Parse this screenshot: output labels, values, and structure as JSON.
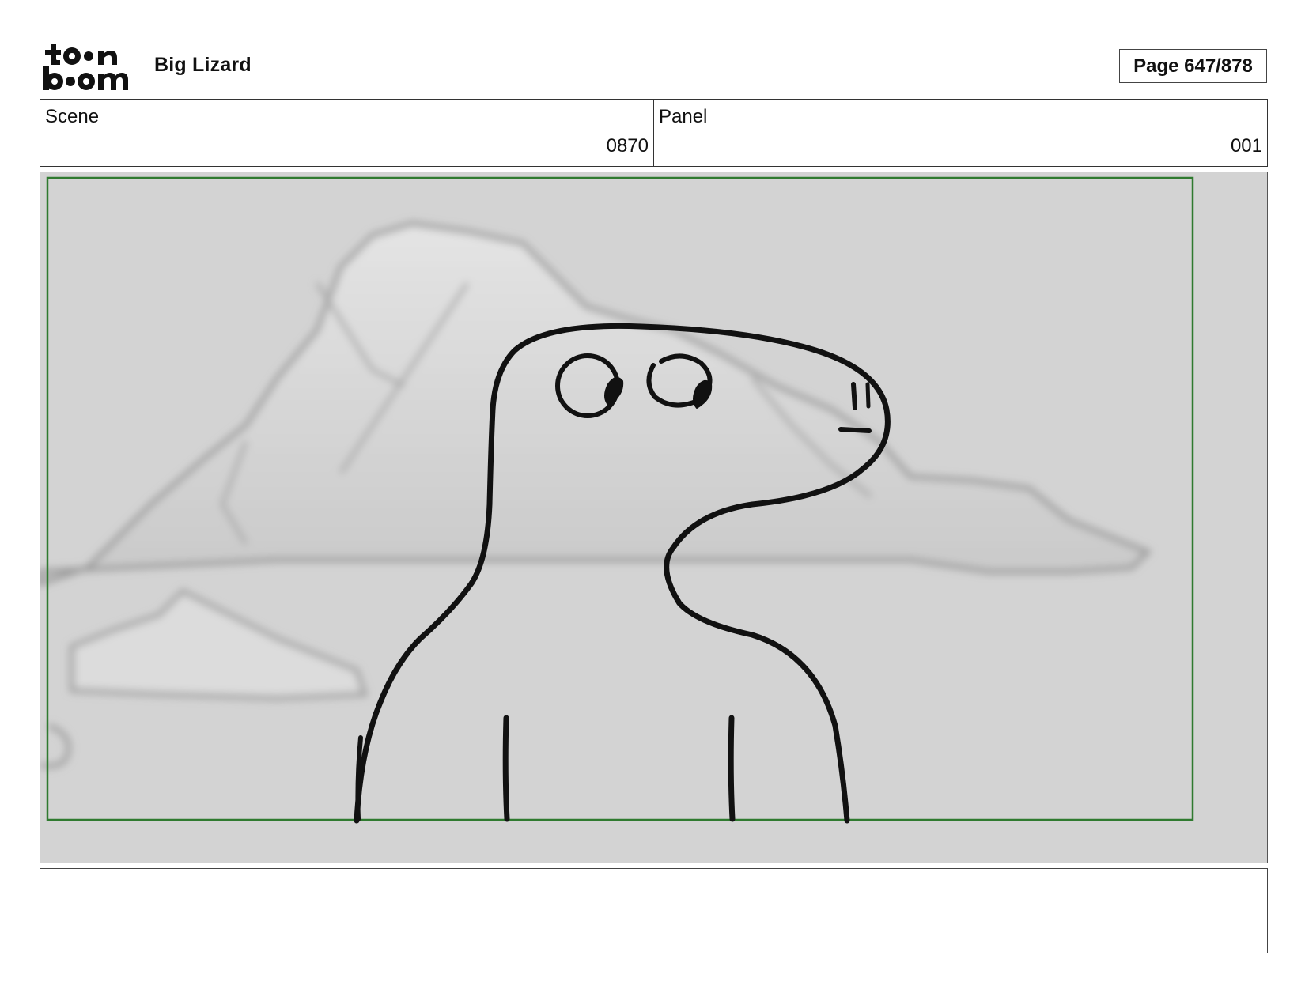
{
  "header": {
    "logo_alt": "toon boom",
    "project_title": "Big Lizard",
    "page_indicator": "Page 647/878"
  },
  "info": {
    "scene_label": "Scene",
    "scene_value": "0870",
    "panel_label": "Panel",
    "panel_value": "001"
  },
  "panel": {
    "safe_frame_color": "#2f7a2f",
    "background_color": "#d3d3d3",
    "line_color": "#111111"
  },
  "notes": {
    "text": ""
  }
}
